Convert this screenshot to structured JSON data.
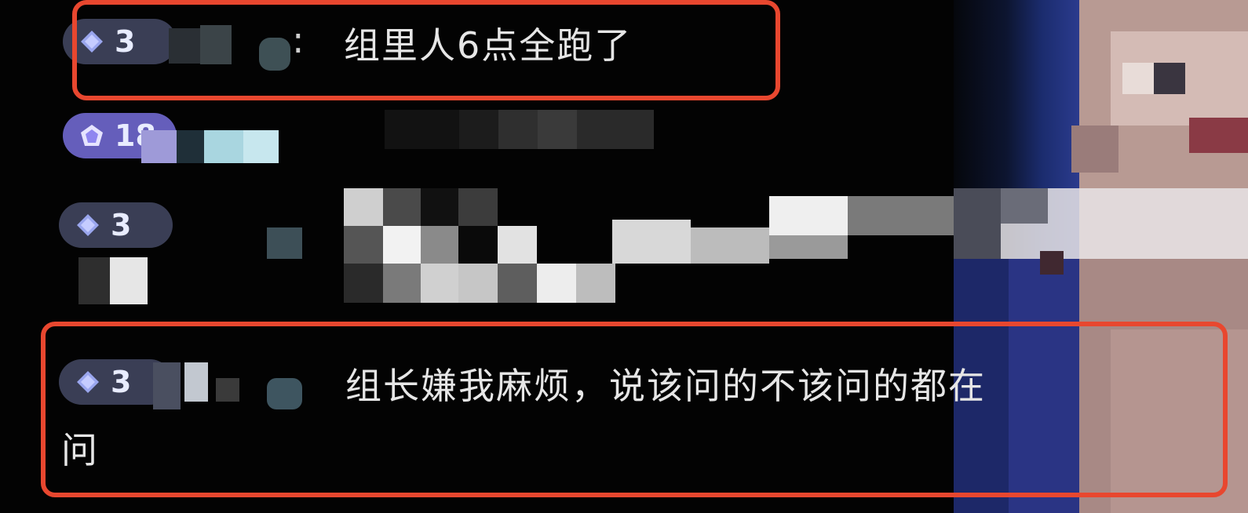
{
  "chat": {
    "messages": [
      {
        "badge_level": "3",
        "badge_icon": "diamond-icon",
        "username": "",
        "separator": ":",
        "text": "组里人6点全跑了",
        "highlighted": true
      },
      {
        "badge_level": "18",
        "badge_icon": "pentagon-icon",
        "username": "",
        "text": "",
        "highlighted": false
      },
      {
        "badge_level": "3",
        "badge_icon": "diamond-icon",
        "username": "",
        "text": "",
        "highlighted": false
      },
      {
        "badge_level": "3",
        "badge_icon": "diamond-icon",
        "username": "",
        "text_line1": "组长嫌我麻烦，说该问的不该问的都在",
        "text_line2": "问",
        "highlighted": true
      }
    ]
  },
  "colors": {
    "highlight_border": "#e8472f",
    "badge_bg": "#6e76a8",
    "badge_purple_bg": "#7f78f0",
    "text": "#e6e6e6",
    "background": "#030303"
  }
}
